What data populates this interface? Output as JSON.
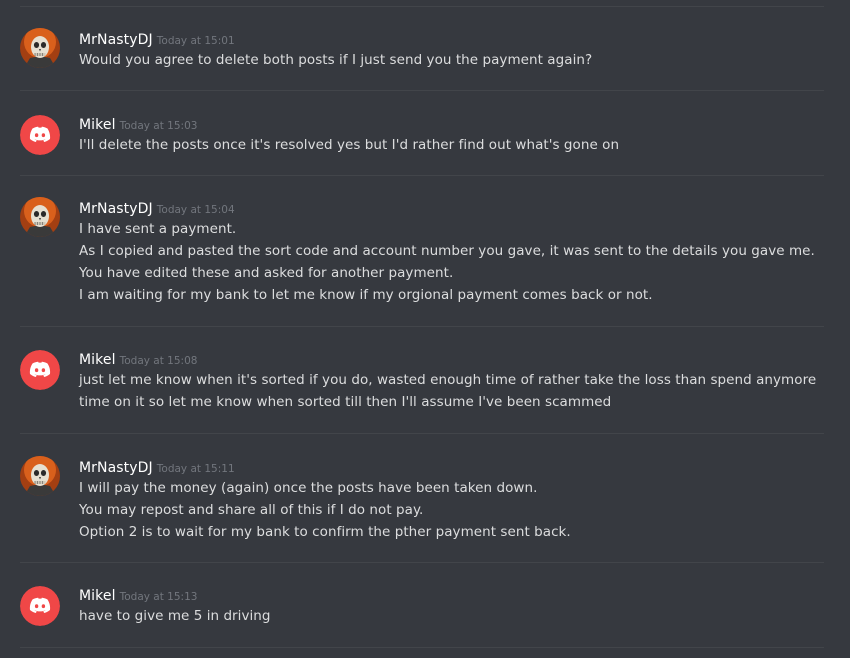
{
  "messages": [
    {
      "author": "MrNastyDJ",
      "timestamp": "Today at 15:01",
      "avatar": "skull-avatar",
      "lines": [
        "Would you agree to delete both posts if I just send you the payment again?"
      ]
    },
    {
      "author": "Mikel",
      "timestamp": "Today at 15:03",
      "avatar": "discord-default-avatar",
      "lines": [
        "I'll delete the posts once it's resolved yes but I'd rather find out what's gone on"
      ]
    },
    {
      "author": "MrNastyDJ",
      "timestamp": "Today at 15:04",
      "avatar": "skull-avatar",
      "lines": [
        "I have sent a payment.",
        "As I copied and pasted the sort code and account number you gave, it was sent to the details you gave me.",
        "You have edited these and asked for another payment.",
        "I am waiting for my bank to let me know if my orgional payment comes back or not."
      ]
    },
    {
      "author": "Mikel",
      "timestamp": "Today at 15:08",
      "avatar": "discord-default-avatar",
      "lines": [
        "just let me know when it's sorted if you do, wasted enough time of rather take the loss than spend anymore",
        "time on it so let me know when sorted till then I'll assume I've been scammed"
      ]
    },
    {
      "author": "MrNastyDJ",
      "timestamp": "Today at 15:11",
      "avatar": "skull-avatar",
      "lines": [
        "I will pay the money (again) once the posts have been taken down.",
        "You may repost and share all of this if I do not pay.",
        "Option 2 is to wait for my bank to confirm the pther payment sent back."
      ]
    },
    {
      "author": "Mikel",
      "timestamp": "Today at 15:13",
      "avatar": "discord-default-avatar",
      "lines": [
        "have to give me 5 in driving"
      ]
    }
  ],
  "colors": {
    "background": "#36393f",
    "divider": "#42454a",
    "author": "#ffffff",
    "timestamp": "#72767d",
    "text": "#dcddde",
    "discord_avatar": "#f04747"
  }
}
